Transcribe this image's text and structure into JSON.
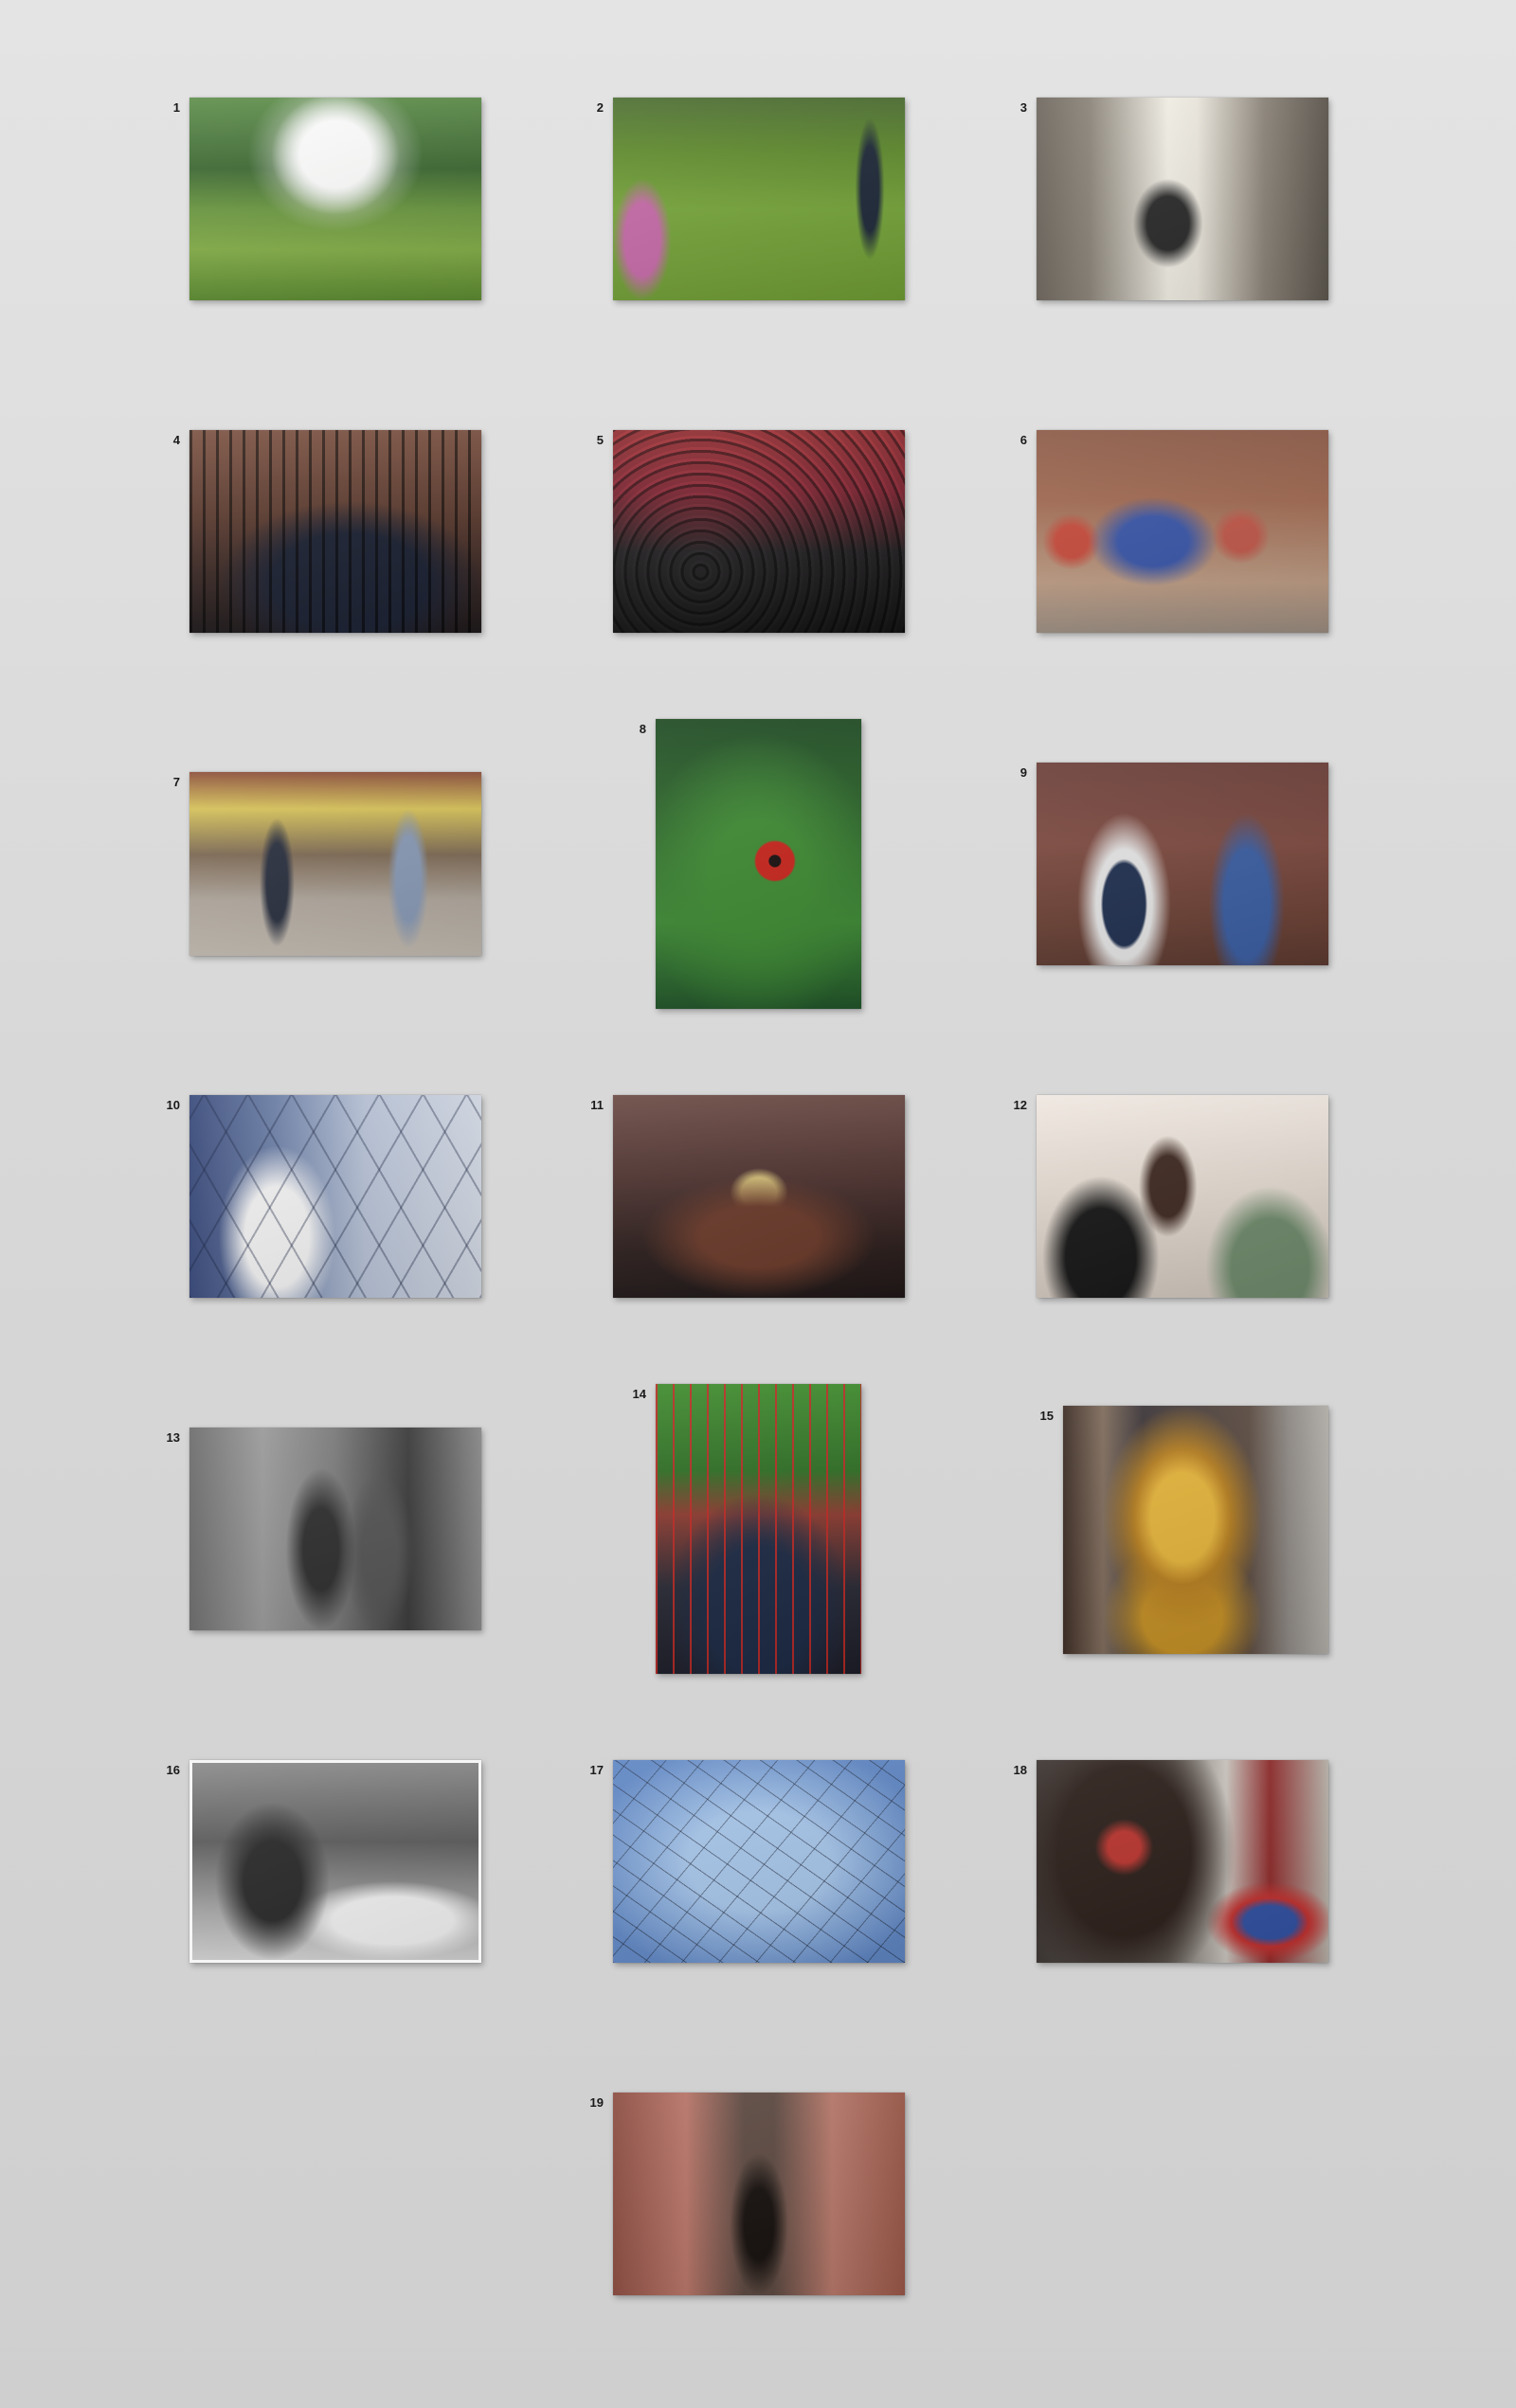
{
  "contact_sheet": {
    "photos": [
      {
        "number": "1"
      },
      {
        "number": "2"
      },
      {
        "number": "3"
      },
      {
        "number": "4"
      },
      {
        "number": "5"
      },
      {
        "number": "6"
      },
      {
        "number": "7"
      },
      {
        "number": "8"
      },
      {
        "number": "9"
      },
      {
        "number": "10"
      },
      {
        "number": "11"
      },
      {
        "number": "12"
      },
      {
        "number": "13"
      },
      {
        "number": "14"
      },
      {
        "number": "15"
      },
      {
        "number": "16"
      },
      {
        "number": "17"
      },
      {
        "number": "18"
      },
      {
        "number": "19"
      }
    ]
  },
  "colors": {
    "background": "#dadada",
    "label_text": "#1a1a1a"
  }
}
